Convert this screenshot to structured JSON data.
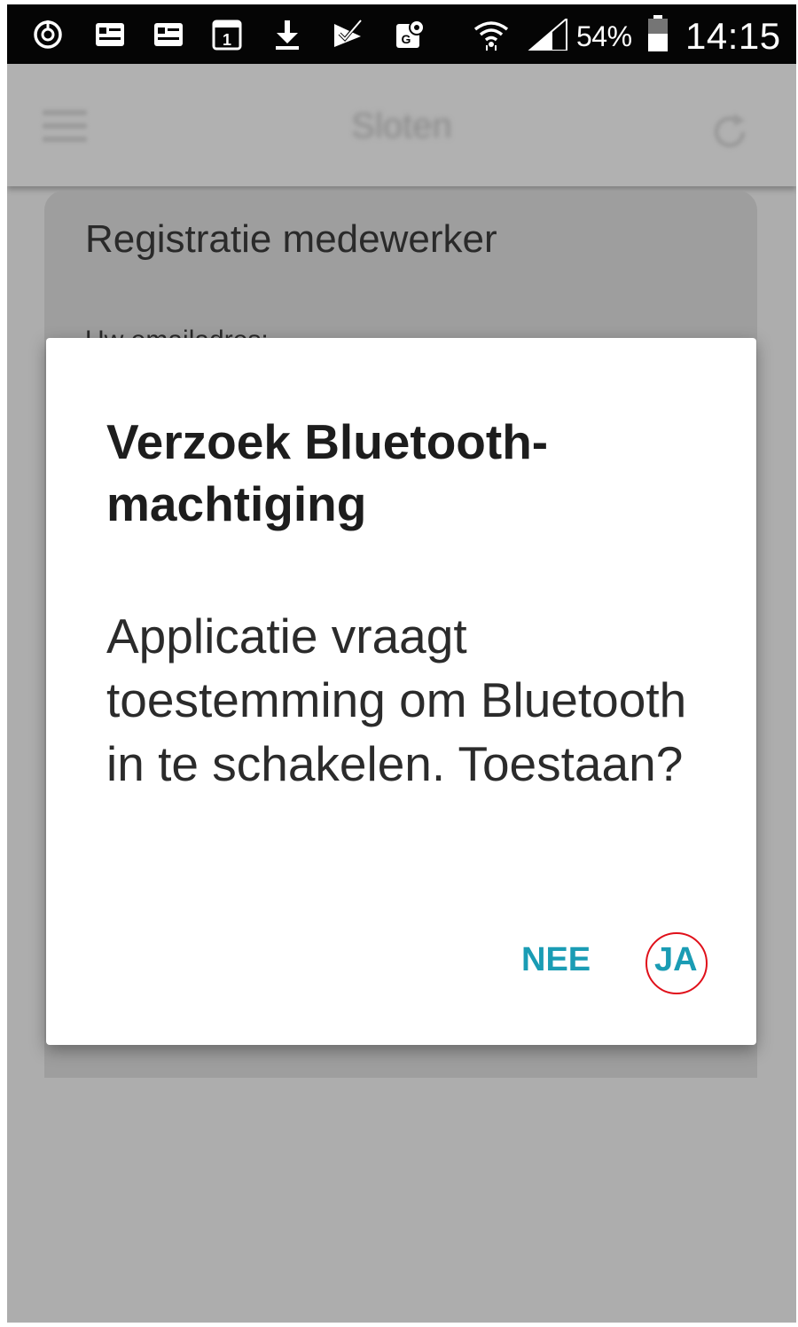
{
  "status_bar": {
    "battery_percent": "54%",
    "time": "14:15",
    "icons": [
      "sync-icon",
      "notification-card-icon",
      "notification-card-icon",
      "calendar-icon",
      "download-icon",
      "checkmark-icon",
      "maps-icon",
      "wifi-icon",
      "signal-icon",
      "battery-icon"
    ],
    "calendar_day": "1"
  },
  "toolbar": {
    "title": "Sloten",
    "menu_icon": "hamburger-menu-icon",
    "refresh_icon": "refresh-icon"
  },
  "background_card": {
    "title": "Registratie medewerker",
    "field_label": "Uw emailadres:"
  },
  "dialog": {
    "title": "Verzoek Bluetooth-machtiging",
    "title_line1": "Verzoek Bluetooth-",
    "title_line2": "machtiging",
    "message": "Applicatie vraagt toestemming om Bluetooth in te schakelen. Toestaan?",
    "no_label": "NEE",
    "yes_label": "JA",
    "accent_color": "#1a9cb4",
    "highlight_color": "#e0101a"
  }
}
